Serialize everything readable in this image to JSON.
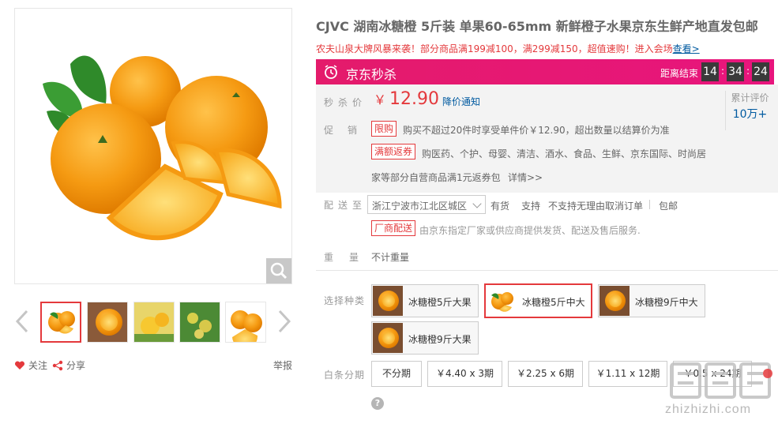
{
  "product": {
    "title": "CJVC 湖南冰糖橙 5斤装 单果60-65mm 新鲜橙子水果京东生鲜产地直发包邮",
    "promo_line": "农夫山泉大牌风暴来袭！部分商品满199减100，满299减150，超值速购！进入会场",
    "promo_link": "查看>"
  },
  "gallery": {
    "follow_label": "关注",
    "share_label": "分享",
    "report_label": "举报",
    "thumb_count": 5
  },
  "seckill": {
    "title": "京东秒杀",
    "countdown_label": "距离结束",
    "hours": "14",
    "minutes": "34",
    "seconds": "24"
  },
  "price": {
    "label": "秒杀价",
    "currency": "￥",
    "value": "12.90",
    "notify_label": "降价通知"
  },
  "reviews": {
    "label": "累计评价",
    "count": "10万+"
  },
  "promotions": {
    "label": "促销",
    "items": [
      {
        "tag": "限购",
        "text": "购买不超过20件时享受单件价￥12.90，超出数量以结算价为准"
      },
      {
        "tag": "满额返券",
        "text": "购医药、个护、母婴、清洁、酒水、食品、生鲜、京东国际、时尚居"
      }
    ],
    "extra_text": "家等部分自营商品满1元返券包",
    "details_link": "详情>>"
  },
  "delivery": {
    "label": "配送至",
    "address": "浙江宁波市江北区城区",
    "stock": "有货",
    "support_label": "支持",
    "no_return": "不支持无理由取消订单",
    "free_ship": "包邮",
    "vendor_tag": "厂商配送",
    "vendor_text": "由京东指定厂家或供应商提供发货、配送及售后服务."
  },
  "weight": {
    "label": "重量",
    "value": "不计重量"
  },
  "variants": {
    "label": "选择种类",
    "options": [
      {
        "label": "冰糖橙5斤大果",
        "selected": false
      },
      {
        "label": "冰糖橙5斤中大",
        "selected": true
      },
      {
        "label": "冰糖橙9斤中大",
        "selected": false
      },
      {
        "label": "冰糖橙9斤大果",
        "selected": false
      }
    ]
  },
  "installments": {
    "label": "白条分期",
    "options": [
      "不分期",
      "￥4.40 x 3期",
      "￥2.25 x 6期",
      "￥1.11 x 12期",
      "￥0.5 x 24期"
    ]
  },
  "watermark": {
    "logo_text": "值值值",
    "domain": "zhizhizhi.com"
  },
  "colors": {
    "accent": "#e4393c",
    "seckill_bg": "#e41b6b",
    "link": "#005aa0",
    "orange": "#f59a12"
  }
}
